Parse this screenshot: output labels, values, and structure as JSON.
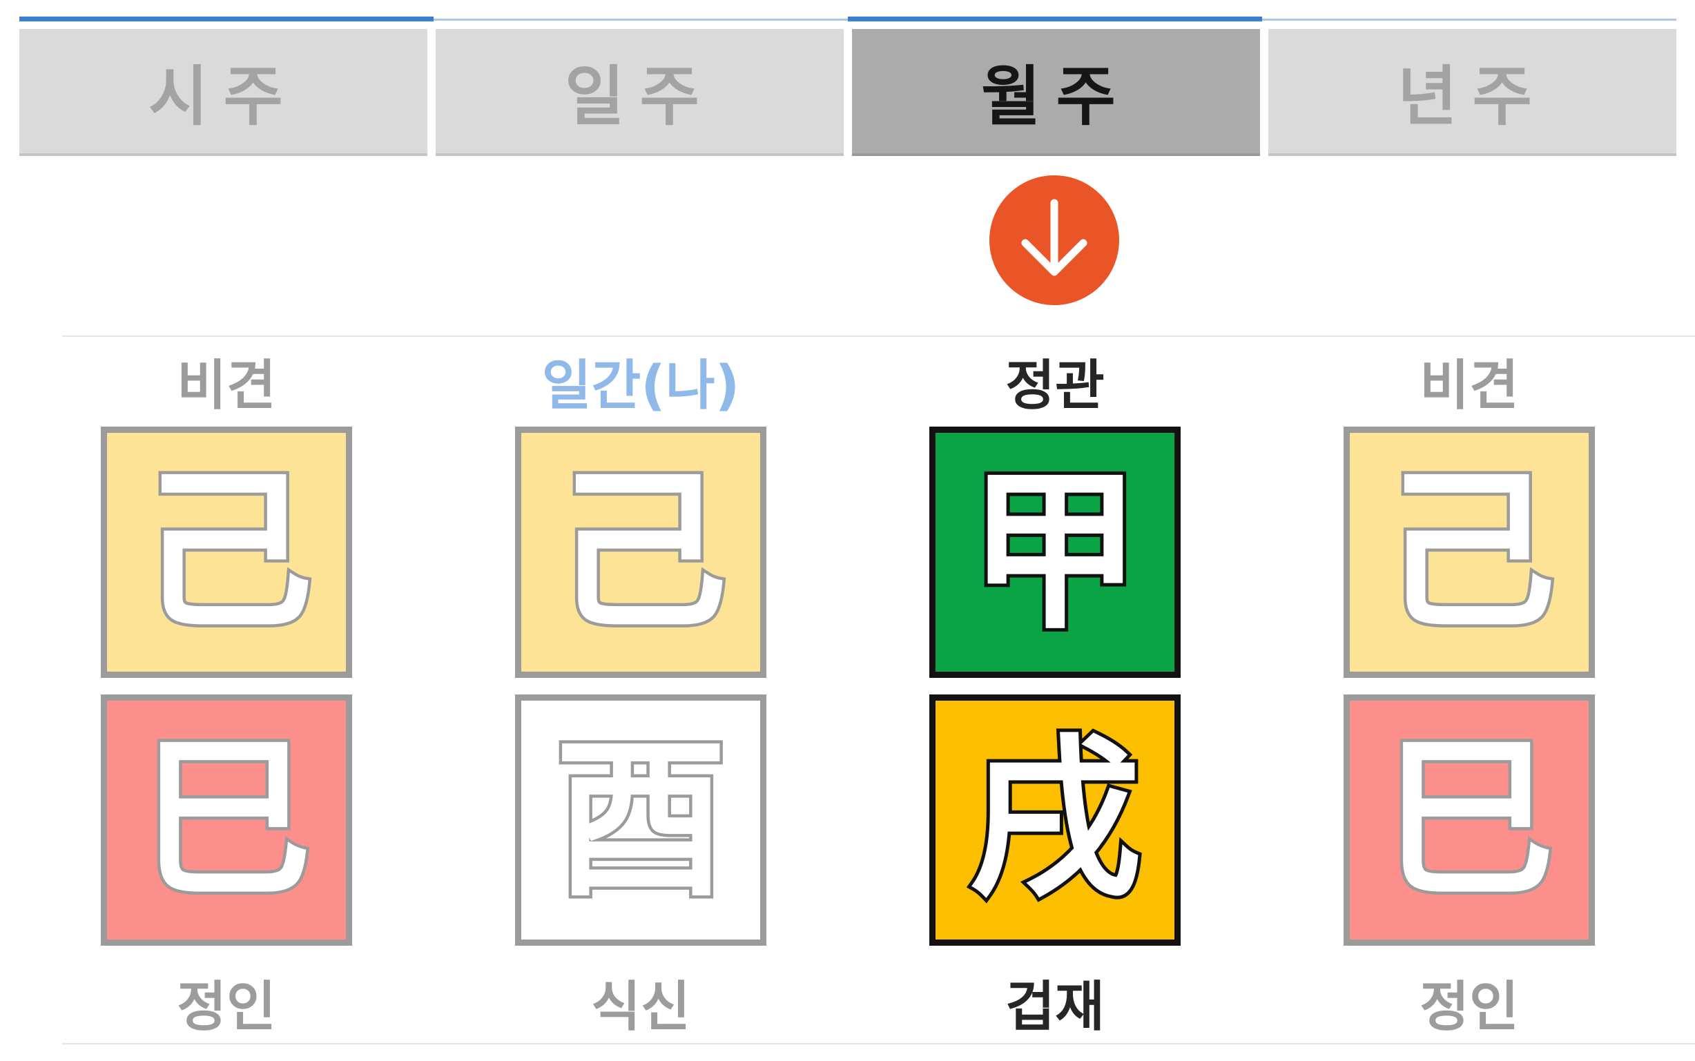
{
  "tabs": [
    {
      "label": "시주"
    },
    {
      "label": "일주"
    },
    {
      "label": "월주",
      "active": true
    },
    {
      "label": "년주"
    }
  ],
  "indicator": {
    "icon": "arrow-down-icon",
    "color": "#ea5528"
  },
  "pillars": [
    {
      "top_label": "비견",
      "stem": {
        "char": "己",
        "color": "#fde395"
      },
      "branch": {
        "char": "巳",
        "color": "#fc8f8b"
      },
      "bottom_label": "정인"
    },
    {
      "top_label": "일간(나)",
      "stem": {
        "char": "己",
        "color": "#fde395"
      },
      "branch": {
        "char": "酉",
        "color": "#ffffff"
      },
      "bottom_label": "식신"
    },
    {
      "top_label": "정관",
      "stem": {
        "char": "甲",
        "color": "#0aa447"
      },
      "branch": {
        "char": "戌",
        "color": "#fcbf00"
      },
      "bottom_label": "겁재"
    },
    {
      "top_label": "비견",
      "stem": {
        "char": "己",
        "color": "#fde395"
      },
      "branch": {
        "char": "巳",
        "color": "#fc8f8b"
      },
      "bottom_label": "정인"
    }
  ]
}
